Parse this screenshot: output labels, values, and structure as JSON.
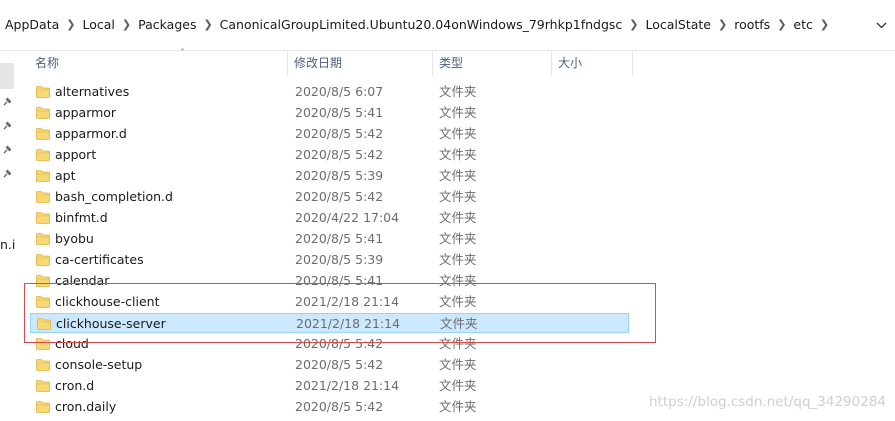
{
  "address_bar": {
    "breadcrumbs": [
      "AppData",
      "Local",
      "Packages",
      "CanonicalGroupLimited.Ubuntu20.04onWindows_79rhkp1fndgsc",
      "LocalState",
      "rootfs",
      "etc"
    ]
  },
  "nav_pane": {
    "truncated_text": "n.i"
  },
  "columns": {
    "name": "名称",
    "date": "修改日期",
    "type": "类型",
    "size": "大小"
  },
  "files": [
    {
      "name": "alternatives",
      "date": "2020/8/5 6:07",
      "type": "文件夹"
    },
    {
      "name": "apparmor",
      "date": "2020/8/5 5:41",
      "type": "文件夹"
    },
    {
      "name": "apparmor.d",
      "date": "2020/8/5 5:42",
      "type": "文件夹"
    },
    {
      "name": "apport",
      "date": "2020/8/5 5:42",
      "type": "文件夹"
    },
    {
      "name": "apt",
      "date": "2020/8/5 5:39",
      "type": "文件夹"
    },
    {
      "name": "bash_completion.d",
      "date": "2020/8/5 5:42",
      "type": "文件夹"
    },
    {
      "name": "binfmt.d",
      "date": "2020/4/22 17:04",
      "type": "文件夹"
    },
    {
      "name": "byobu",
      "date": "2020/8/5 5:41",
      "type": "文件夹"
    },
    {
      "name": "ca-certificates",
      "date": "2020/8/5 5:39",
      "type": "文件夹"
    },
    {
      "name": "calendar",
      "date": "2020/8/5 5:41",
      "type": "文件夹"
    },
    {
      "name": "clickhouse-client",
      "date": "2021/2/18 21:14",
      "type": "文件夹"
    },
    {
      "name": "clickhouse-server",
      "date": "2021/2/18 21:14",
      "type": "文件夹",
      "selected": true
    },
    {
      "name": "cloud",
      "date": "2020/8/5 5:42",
      "type": "文件夹"
    },
    {
      "name": "console-setup",
      "date": "2020/8/5 5:42",
      "type": "文件夹"
    },
    {
      "name": "cron.d",
      "date": "2021/2/18 21:14",
      "type": "文件夹"
    },
    {
      "name": "cron.daily",
      "date": "2020/8/5 5:42",
      "type": "文件夹"
    }
  ],
  "watermark": "https://blog.csdn.net/qq_34290284",
  "colors": {
    "selection": "#cce8ff",
    "selection_border": "#99d1ff",
    "annotation": "#d9494d",
    "folder": "#f8d775"
  }
}
